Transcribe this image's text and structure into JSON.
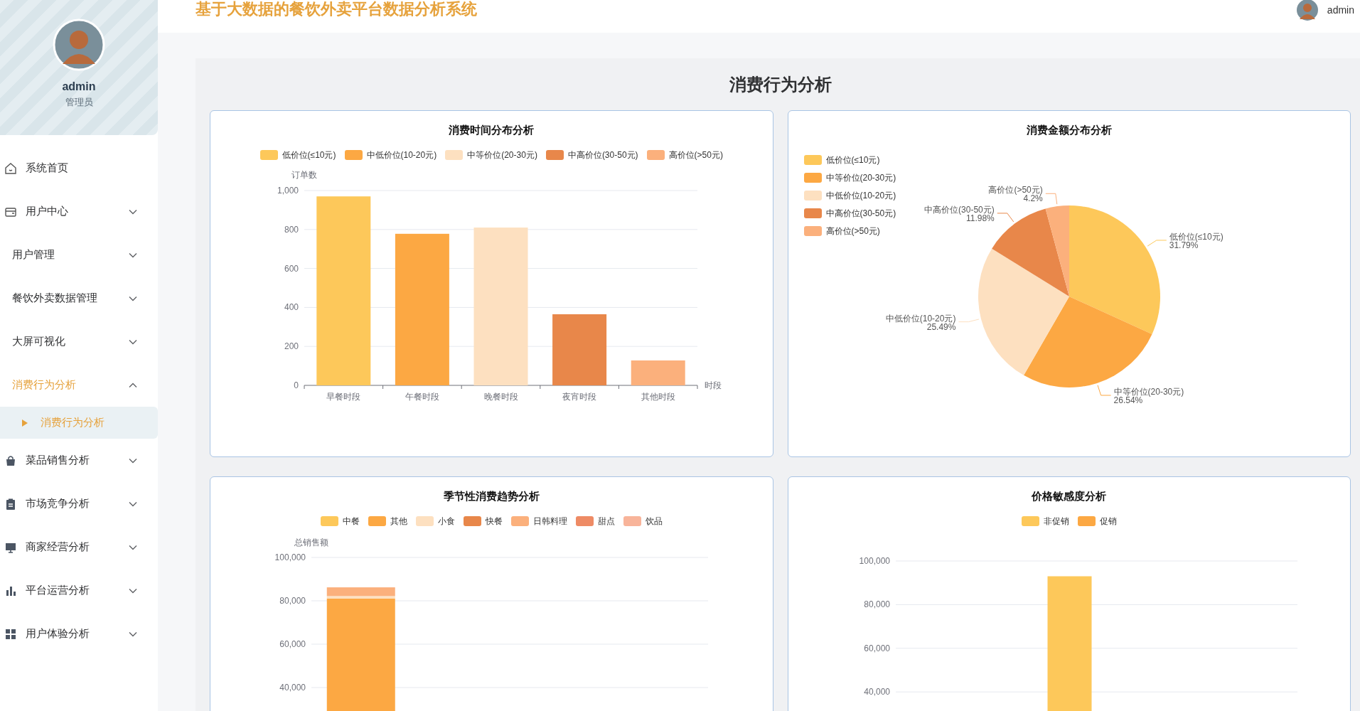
{
  "sidebar": {
    "user": {
      "name": "admin",
      "role": "管理员"
    },
    "items": [
      {
        "label": "系统首页",
        "selected": false
      },
      {
        "label": "用户中心",
        "expanded": false,
        "selected": false
      },
      {
        "label": "用户管理",
        "expanded": false,
        "selected": false
      },
      {
        "label": "餐饮外卖数据管理",
        "expanded": false,
        "selected": false
      },
      {
        "label": "大屏可视化",
        "expanded": false,
        "selected": false
      },
      {
        "label": "消费行为分析",
        "expanded": true,
        "selected": true,
        "children": [
          {
            "label": "消费行为分析",
            "selected": true
          }
        ]
      },
      {
        "label": "菜品销售分析",
        "expanded": false,
        "selected": false
      },
      {
        "label": "市场竞争分析",
        "expanded": false,
        "selected": false
      },
      {
        "label": "商家经营分析",
        "expanded": false,
        "selected": false
      },
      {
        "label": "平台运营分析",
        "expanded": false,
        "selected": false
      },
      {
        "label": "用户体验分析",
        "expanded": false,
        "selected": false
      }
    ]
  },
  "header": {
    "title": "基于大数据的餐饮外卖平台数据分析系统",
    "user": "admin"
  },
  "page_title": "消费行为分析",
  "cards": [
    {
      "title": "消费时间分布分析",
      "legend": [
        {
          "label": "低价位(≤10元)",
          "color": "#fdc85a"
        },
        {
          "label": "中低价位(10-20元)",
          "color": "#fca843"
        },
        {
          "label": "中等价位(20-30元)",
          "color": "#fde0c0"
        },
        {
          "label": "中高价位(30-50元)",
          "color": "#e8874a"
        },
        {
          "label": "高价位(>50元)",
          "color": "#fbb07c"
        }
      ],
      "chart_data": {
        "type": "bar",
        "grid": true,
        "ylabel": "订单数",
        "xlabel": "时段",
        "categories": [
          "早餐时段",
          "午餐时段",
          "晚餐时段",
          "夜宵时段",
          "其他时段"
        ],
        "values": [
          970,
          778,
          810,
          365,
          128
        ],
        "ylim": [
          0,
          1000
        ],
        "yticks": [
          {
            "value": 0,
            "label": "0"
          },
          {
            "value": 200,
            "label": "200"
          },
          {
            "value": 400,
            "label": "400"
          },
          {
            "value": 600,
            "label": "600"
          },
          {
            "value": 800,
            "label": "800"
          },
          {
            "value": 1000,
            "label": "1,000"
          }
        ]
      }
    },
    {
      "title": "消费金额分布分析",
      "legend": [
        {
          "label": "低价位(≤10元)",
          "color": "#fdc85a"
        },
        {
          "label": "中等价位(20-30元)",
          "color": "#fca843"
        },
        {
          "label": "中低价位(10-20元)",
          "color": "#fde0c0"
        },
        {
          "label": "中高价位(30-50元)",
          "color": "#e8874a"
        },
        {
          "label": "高价位(>50元)",
          "color": "#fbb07c"
        }
      ],
      "chart_data": {
        "type": "pie",
        "categories": [
          "低价位(≤10元)",
          "中等价位(20-30元)",
          "中低价位(10-20元)",
          "中高价位(30-50元)",
          "高价位(>50元)"
        ],
        "values": [
          31.79,
          26.54,
          25.49,
          11.98,
          4.2
        ],
        "value_labels": [
          "31.79%",
          "26.54%",
          "25.49%",
          "11.98%",
          "4.2%"
        ]
      }
    },
    {
      "title": "季节性消费趋势分析",
      "chart_data": {
        "type": "bar",
        "grid": true,
        "stacked": true,
        "ylabel": "总销售额",
        "ylim": [
          0,
          100000
        ],
        "yticks": [
          {
            "value": 40000,
            "label": "40,000"
          },
          {
            "value": 60000,
            "label": "60,000"
          },
          {
            "value": 80000,
            "label": "80,000"
          },
          {
            "value": 100000,
            "label": "100,000"
          }
        ],
        "series": [
          {
            "name": "中餐",
            "color": "#fdc85a",
            "values": [
              null
            ]
          },
          {
            "name": "其他",
            "color": "#fca843",
            "values": [
              81000
            ]
          },
          {
            "name": "小食",
            "color": "#fde0c0",
            "values": [
              1200
            ]
          },
          {
            "name": "快餐",
            "color": "#e8874a",
            "values": [
              null
            ]
          },
          {
            "name": "日韩料理",
            "color": "#fbb07c",
            "values": [
              4000
            ]
          },
          {
            "name": "甜点",
            "color": "#ee8b65",
            "values": [
              null
            ]
          },
          {
            "name": "饮品",
            "color": "#f8b49a",
            "values": [
              null
            ]
          }
        ]
      }
    },
    {
      "title": "价格敏感度分析",
      "chart_data": {
        "type": "bar",
        "grid": true,
        "stacked": false,
        "ylim": [
          0,
          100000
        ],
        "yticks": [
          {
            "value": 40000,
            "label": "40,000"
          },
          {
            "value": 60000,
            "label": "60,000"
          },
          {
            "value": 80000,
            "label": "80,000"
          },
          {
            "value": 100000,
            "label": "100,000"
          }
        ],
        "series": [
          {
            "name": "非促销",
            "color": "#fdc85a",
            "values": [
              93000
            ]
          },
          {
            "name": "促销",
            "color": "#fca843",
            "values": [
              null
            ]
          }
        ]
      }
    }
  ]
}
